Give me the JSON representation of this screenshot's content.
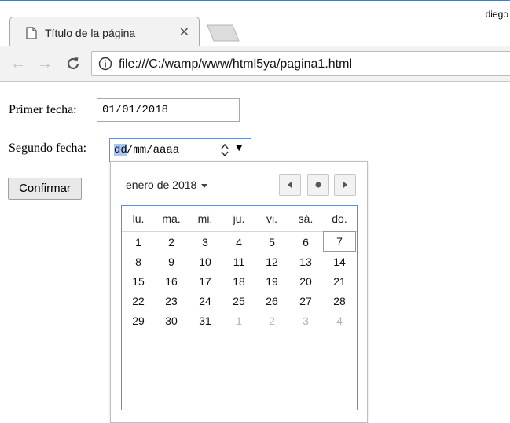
{
  "browser": {
    "user": "diego",
    "tab_title": "Título de la página",
    "url": "file:///C:/wamp/www/html5ya/pagina1.html"
  },
  "form": {
    "label1": "Primer fecha:",
    "date1_value": "01/01/2018",
    "label2": "Segundo fecha:",
    "date2_day_seg": "dd",
    "date2_rest": "/mm/aaaa",
    "confirm_label": "Confirmar"
  },
  "calendar": {
    "month_label": "enero de 2018",
    "weekdays": [
      "lu.",
      "ma.",
      "mi.",
      "ju.",
      "vi.",
      "sá.",
      "do."
    ],
    "weeks": [
      [
        "1",
        "2",
        "3",
        "4",
        "5",
        "6",
        "7"
      ],
      [
        "8",
        "9",
        "10",
        "11",
        "12",
        "13",
        "14"
      ],
      [
        "15",
        "16",
        "17",
        "18",
        "19",
        "20",
        "21"
      ],
      [
        "22",
        "23",
        "24",
        "25",
        "26",
        "27",
        "28"
      ],
      [
        "29",
        "30",
        "31",
        "1",
        "2",
        "3",
        "4"
      ]
    ],
    "highlighted_day": "7",
    "colors": {
      "accent": "#4d90fe",
      "grid_border": "#5b8ed6",
      "other_month": "#b3b3b3"
    }
  }
}
